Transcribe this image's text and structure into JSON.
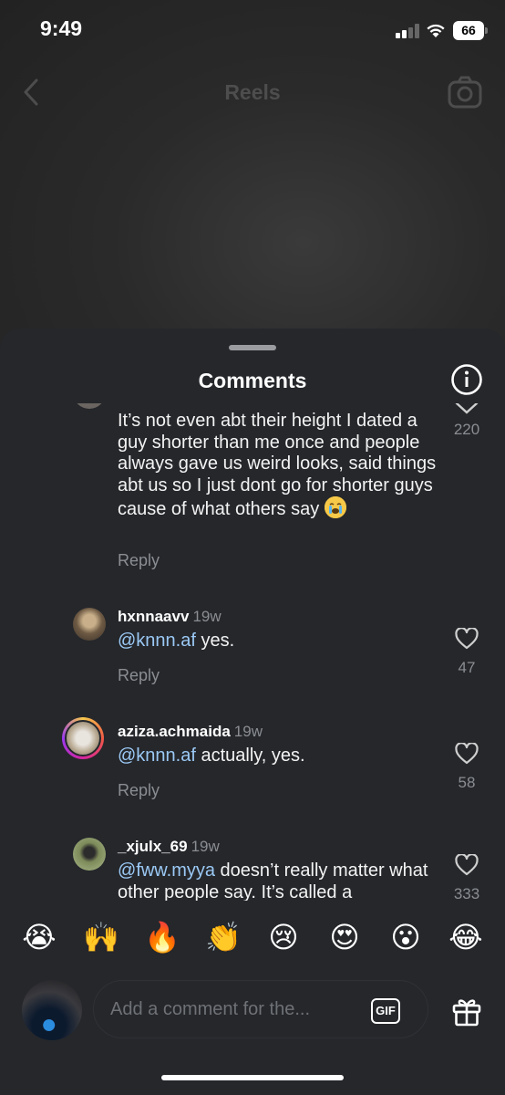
{
  "status_bar": {
    "time": "9:49",
    "battery": "66"
  },
  "header": {
    "title": "Reels"
  },
  "sheet": {
    "title": "Comments"
  },
  "comments": [
    {
      "username": "",
      "age": "",
      "text": "It’s not even abt their height I dated a guy shorter than me once and people always gave us weird looks, said things abt us so I just dont go for shorter guys cause of what others say",
      "emoji": "😭",
      "reply_label": "Reply",
      "likes": "220"
    },
    {
      "username": "hxnnaavv",
      "age": "19w",
      "mention": "@knnn.af",
      "text": " yes.",
      "reply_label": "Reply",
      "likes": "47"
    },
    {
      "username": "aziza.achmaida",
      "age": "19w",
      "mention": "@knnn.af",
      "text": " actually, yes.",
      "reply_label": "Reply",
      "likes": "58"
    },
    {
      "username": "_xjulx_69",
      "age": "19w",
      "mention": "@fww.myya",
      "text": " doesn’t really matter what other people say. It’s called a",
      "likes": "333"
    }
  ],
  "reactions": [
    "😭",
    "🙌",
    "🔥",
    "👏",
    "😢",
    "😍",
    "😮",
    "😂"
  ],
  "composer": {
    "placeholder": "Add a comment for the...",
    "gif_label": "GIF"
  },
  "colors": {
    "sheet_bg": "#25272b",
    "mention": "#9bc9f5",
    "muted": "#8a8d92"
  }
}
